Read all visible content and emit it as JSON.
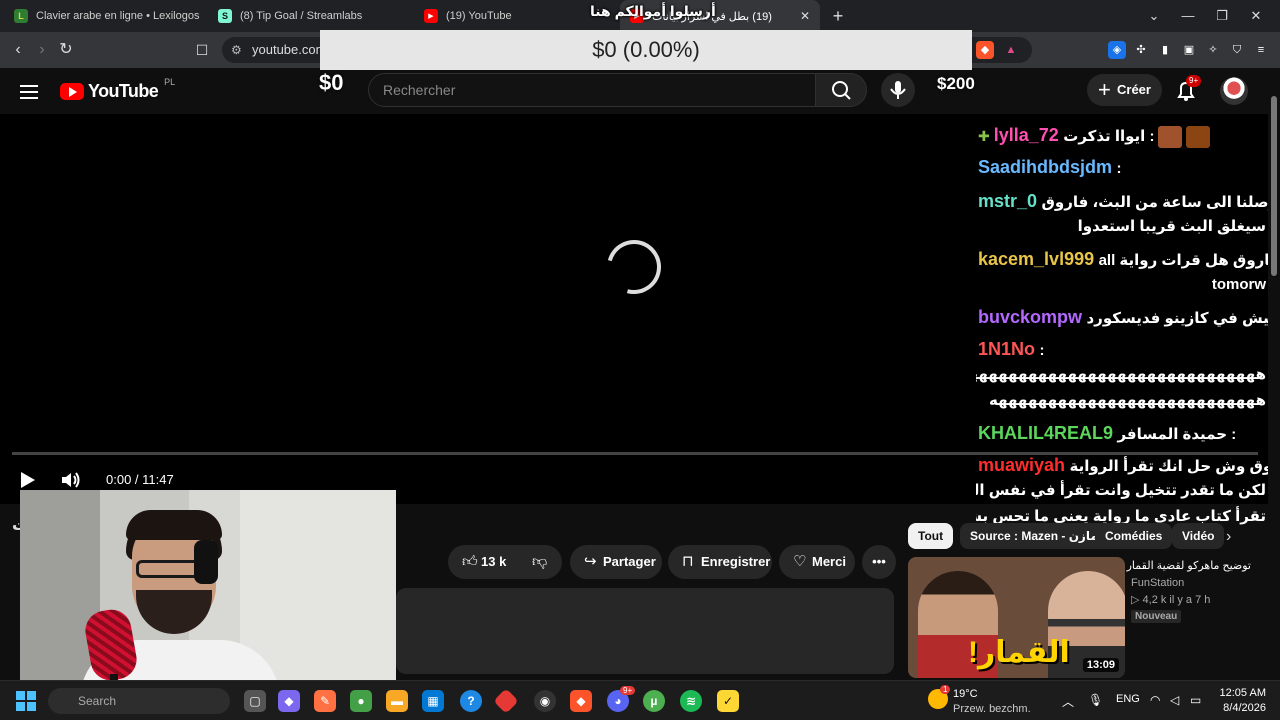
{
  "browser": {
    "tabs": [
      {
        "title": "Clavier arabe en ligne • Lexilogos",
        "favicon": "L",
        "favicon_color": "#7cb342"
      },
      {
        "title": "(8) Tip Goal / Streamlabs",
        "favicon": "S",
        "favicon_color": "#80f5d2"
      },
      {
        "title": "(19) YouTube",
        "favicon": "▶",
        "favicon_color": "#ff0000"
      },
      {
        "title": "(19) بطل في اسرار بيانات",
        "favicon": "▶",
        "favicon_color": "#ff0000"
      }
    ],
    "url": "youtube.com",
    "new_tab_icon": "plus-icon"
  },
  "overlay": {
    "goal_title": "أرسلوا أموالكم هنا",
    "goal_progress": "$0 (0.00%)",
    "goal_min": "$0",
    "goal_max": "$200",
    "goal_fraction": 0
  },
  "youtube": {
    "logo_text": "YouTube",
    "country": "PL",
    "search_placeholder": "Rechercher",
    "create_label": "Créer",
    "notifications_badge": "9+",
    "player": {
      "time": "0:00 / 11:47",
      "progress_fraction": 0
    },
    "title_partial": "ت",
    "actions": {
      "likes": "13 k",
      "share": "Partager",
      "save": "Enregistrer",
      "thanks": "Merci"
    },
    "chips": [
      "Tout",
      "Source : Mazen - مازن",
      "Comédies",
      "Vidéo"
    ],
    "recommended": {
      "title": "توضيح ماهركو لقضية القمار",
      "channel": "FunStation",
      "meta": "▷ 4,2 k  il y a 7 h",
      "badge": "Nouveau",
      "duration": "13:09",
      "thumb_text": "القمار!"
    }
  },
  "chat": [
    {
      "user": "lylla_72",
      "color": "#ff4fb0",
      "msg": "ايواا تذكرت :",
      "badge": true
    },
    {
      "user": "Saadihdbdsjdm",
      "color": "#69b9ff",
      "msg": ":"
    },
    {
      "user": "mstr_0",
      "color": "#66e0c8",
      "msg": "وصلنا الى ساعة من البث، فاروق :"
    },
    {
      "cont": "سيغلق البث قريبا استعدوا"
    },
    {
      "user": "kacem_lvl999",
      "color": "#e8c44a",
      "msg": "all فاروق هل قرات رواية :"
    },
    {
      "cont": "tomorw"
    },
    {
      "user": "buvckompw",
      "color": "#b368ff",
      "msg": "ليش في كازينو فديسكورد :"
    },
    {
      "user": "1N1No",
      "color": "#ff5555",
      "msg": ":"
    },
    {
      "cont": "هههههههههههههههههههههههههههههههههههههه"
    },
    {
      "cont": "هههههههههههههههههههههههههههه"
    },
    {
      "user": "KHALIL4REAL9",
      "color": "#5cd65c",
      "msg": "حميدة المسافر :"
    },
    {
      "user": "muawiyah",
      "color": "#ff2d2d",
      "msg": "فاروق وش حل انك تقرأ الرواية :"
    },
    {
      "cont": "لكن ما تقدر تتخيل وانت تقرأ في نفس الوقت كانك"
    },
    {
      "cont": "تقرأ كتاب عادي ما رواية يعني ما تحس بشيء"
    }
  ],
  "taskbar": {
    "search_label": "Search",
    "weather_temp": "19°C",
    "weather_cond": "Przew. bezchm.",
    "weather_badge": "1",
    "lang": "ENG",
    "time": "12:05 AM",
    "date": "8/4/2026",
    "discord_badge": "9+"
  },
  "colors": {
    "yt_red": "#ff0000",
    "bg": "#0f0f0f",
    "chip_bg": "#272727"
  }
}
